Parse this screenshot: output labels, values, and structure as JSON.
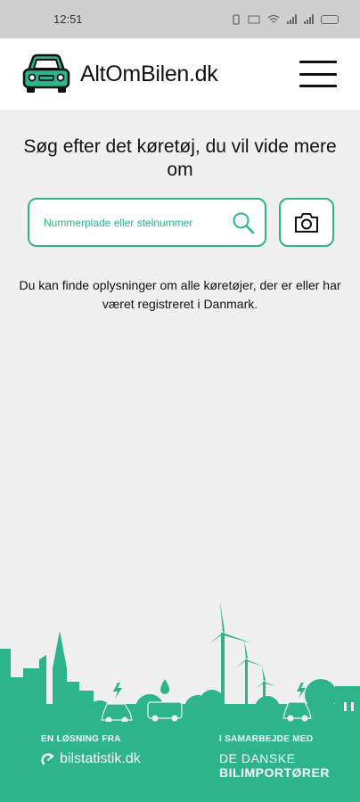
{
  "status_bar": {
    "time": "12:51"
  },
  "header": {
    "brand": "AltOmBilen.dk"
  },
  "main": {
    "headline": "Søg efter det køretøj, du vil vide mere om",
    "search_placeholder": "Nummerplade eller stelnummer",
    "info_text": "Du kan finde oplysninger om alle køretøjer, der er eller har været registreret i Danmark."
  },
  "footer": {
    "left_kicker": "EN LØSNING FRA",
    "left_brand": "bilstatistik.dk",
    "right_kicker": "I SAMARBEJDE MED",
    "right_brand_line1": "DE DANSKE",
    "right_brand_line2": "BILIMPORTØRER"
  },
  "colors": {
    "accent": "#2db48a",
    "background": "#f0f0f0",
    "status_bar": "#cfcfcf"
  },
  "icons": [
    "car-logo-icon",
    "menu-icon",
    "search-icon",
    "camera-icon",
    "bilstatistik-icon"
  ]
}
